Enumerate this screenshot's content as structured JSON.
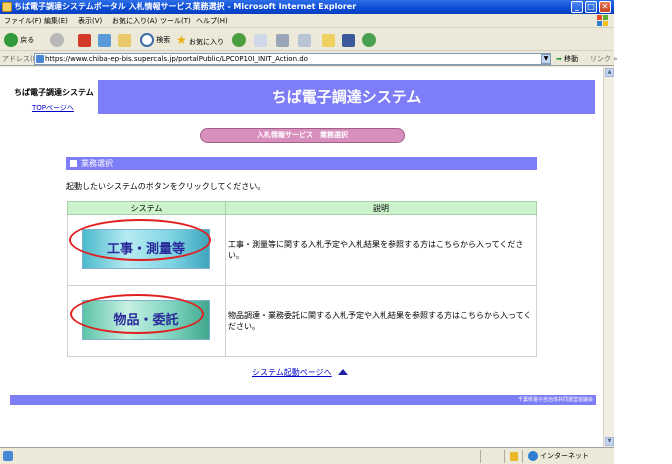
{
  "window": {
    "title": "ちば電子調達システムポータル 入札情報サービス業務選択 - Microsoft Internet Explorer",
    "minimize": "_",
    "maximize": "□",
    "close": "✕"
  },
  "menu": [
    "ファイル(F)",
    "編集(E)",
    "表示(V)",
    "お気に入り(A)",
    "ツール(T)",
    "ヘルプ(H)"
  ],
  "toolbar": {
    "back_label": "戻る",
    "search_label": "検索",
    "favorites_label": "お気に入り"
  },
  "address": {
    "label": "アドレス(D)",
    "url": "https://www.chiba-ep-bis.supercals.jp/portalPublic/LPC0P10I_INIT_Action.do",
    "go_label": "移動",
    "links_label": "リンク »"
  },
  "page": {
    "site_name": "ちば電子調達システム",
    "top_link": "TOPページへ",
    "banner": "ちば電子調達システム",
    "service_title": "入札情報サービス　業務選択",
    "section_title": "業務選択",
    "instruction": "起動したいシステムのボタンをクリックしてください。",
    "table": {
      "headers": [
        "システム",
        "説明"
      ],
      "rows": [
        {
          "button": "工事・測量等",
          "description": "工事・測量等に関する入札予定や入札結果を参照する方はこちらから入ってください。"
        },
        {
          "button": "物品・委託",
          "description": "物品調達・業務委託に関する入札予定や入札結果を参照する方はこちらから入ってください。"
        }
      ]
    },
    "system_start_link": "システム起動ページへ",
    "footer": "千葉県電子自治体共同運営協議会"
  },
  "status": {
    "zone": "インターネット"
  },
  "colors": {
    "banner": "#7d7df7",
    "table_header": "#ccf3cc",
    "service_pill": "#d98fbd",
    "highlight_oval": "#e02020"
  }
}
